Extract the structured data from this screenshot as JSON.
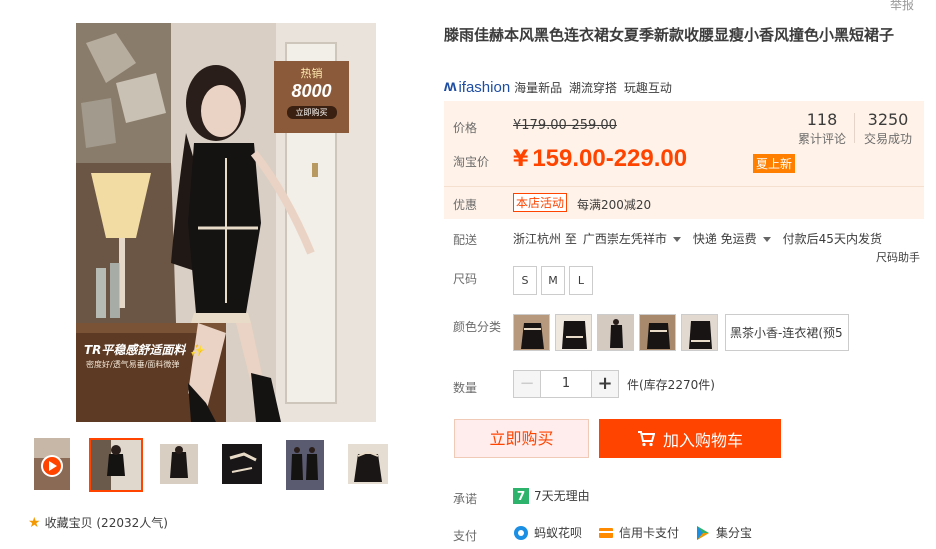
{
  "top": {
    "report_label": "举报"
  },
  "gallery": {
    "badge_line1": "热销",
    "badge_line2": "8000",
    "badge_line3": "立即购买",
    "caption_main": "TR平稳感舒适面料 ✨",
    "caption_sub": "密度好/透气易垂/面料微弹",
    "thumb_count": 7,
    "active_thumb_index": 1
  },
  "favorite": {
    "icon": "star-icon",
    "label": "收藏宝贝 (22032人气)"
  },
  "product": {
    "title": "滕雨佳赫本风黑色连衣裙女夏季新款收腰显瘦小香风撞色小黑短裙子",
    "brand_name": "ifashion",
    "brand_tags": [
      "海量新品",
      "潮流穿搭",
      "玩趣互动"
    ]
  },
  "price": {
    "label_price": "价格",
    "old_price": "¥179.00-259.00",
    "label_taobao": "淘宝价",
    "currency": "¥",
    "now_price": "159.00-229.00",
    "promo_badge": "夏上新",
    "reviews_num": "118",
    "reviews_label": "累计评论",
    "sales_num": "3250",
    "sales_label": "交易成功",
    "label_discount": "优惠",
    "coupon_tag": "本店活动",
    "coupon_text": "每满200减20"
  },
  "shipping": {
    "label": "配送",
    "from": "浙江杭州 至",
    "to": "广西崇左凭祥市",
    "method": "快递 免运费",
    "note": "付款后45天内发货"
  },
  "size": {
    "label": "尺码",
    "options": [
      "S",
      "M",
      "L"
    ],
    "helper": "尺码助手"
  },
  "color": {
    "label": "颜色分类",
    "swatch_count": 5,
    "text_option": "黑茶小香-连衣裙(预5"
  },
  "quantity": {
    "label": "数量",
    "value": "1",
    "minus": "−",
    "plus": "+",
    "stock": "件(库存2270件)"
  },
  "actions": {
    "buy_now": "立即购买",
    "add_cart": "加入购物车"
  },
  "promise": {
    "label": "承诺",
    "icon_text": "7",
    "text": "7天无理由"
  },
  "payment": {
    "label": "支付",
    "methods": [
      "蚂蚁花呗",
      "信用卡支付",
      "集分宝"
    ]
  },
  "colors": {
    "accent": "#ff4400",
    "price_bg": "#fff2e8",
    "brand": "#1e4ea3"
  }
}
